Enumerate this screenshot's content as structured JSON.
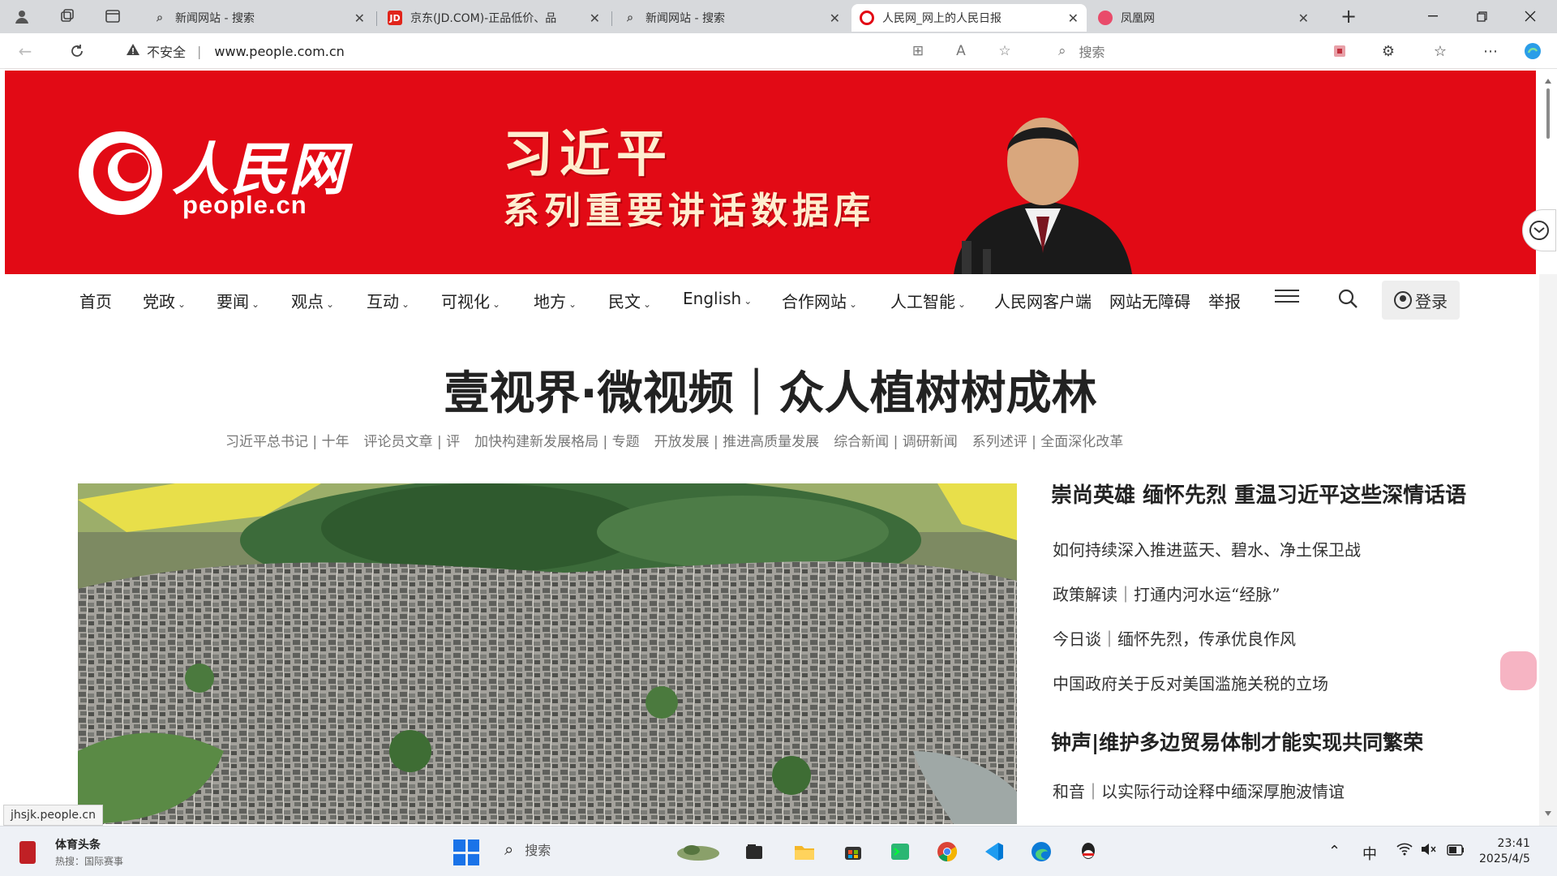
{
  "browser": {
    "tabs": [
      {
        "title": "新闻网站 - 搜索",
        "favicon": "search-icon",
        "active": false
      },
      {
        "title": "京东(JD.COM)-正品低价、品",
        "favicon": "jd-logo-icon",
        "active": false
      },
      {
        "title": "新闻网站 - 搜索",
        "favicon": "search-icon",
        "active": false
      },
      {
        "title": "人民网_网上的人民日报",
        "favicon": "people-logo-icon",
        "active": true
      },
      {
        "title": "凤凰网",
        "favicon": "ifeng-logo-icon",
        "active": false
      }
    ],
    "security_label": "不安全",
    "url": "www.people.com.cn",
    "search_placeholder": "搜索"
  },
  "banner": {
    "logo_cn": "人民网",
    "logo_en": "people.cn",
    "title_line1": "习近平",
    "title_line2": "系列重要讲话数据库",
    "color": "#e20a15"
  },
  "nav": {
    "items": [
      {
        "label": "首页",
        "dropdown": false
      },
      {
        "label": "党政",
        "dropdown": true
      },
      {
        "label": "要闻",
        "dropdown": true
      },
      {
        "label": "观点",
        "dropdown": true
      },
      {
        "label": "互动",
        "dropdown": true
      },
      {
        "label": "可视化",
        "dropdown": true
      },
      {
        "label": "地方",
        "dropdown": true
      },
      {
        "label": "民文",
        "dropdown": true
      },
      {
        "label": "English",
        "dropdown": true
      },
      {
        "label": "合作网站",
        "dropdown": true
      },
      {
        "label": "人工智能",
        "dropdown": true
      },
      {
        "label": "人民网客户端",
        "dropdown": false
      },
      {
        "label": "网站无障碍",
        "dropdown": false
      },
      {
        "label": "举报",
        "dropdown": false
      }
    ],
    "login_label": "登录"
  },
  "main": {
    "headline": "壹视界·微视频｜众人植树树成林",
    "subheads": [
      "习近平总书记 | 十年",
      "评论员文章 | 评",
      "加快构建新发展格局 | 专题",
      "开放发展 | 推进高质量发展",
      "综合新闻 | 调研新闻",
      "系列述评 | 全面深化改革"
    ],
    "side": {
      "heading1": "崇尚英雄 缅怀先烈 重温习近平这些深情话语",
      "items1": [
        "如何持续深入推进蓝天、碧水、净土保卫战",
        "政策解读｜打通内河水运“经脉”",
        "今日谈｜缅怀先烈，传承优良作风",
        "中国政府关于反对美国滥施关税的立场"
      ],
      "heading2": "钟声|维护多边贸易体制才能实现共同繁荣",
      "items2": [
        "和音｜以实际行动诠释中缅深厚胞波情谊"
      ]
    }
  },
  "status_url": "jhsjk.people.cn",
  "taskbar": {
    "widget_title": "体育头条",
    "widget_sub": "热搜：国际赛事",
    "search_label": "搜索",
    "apps": [
      "landscape-widget-icon",
      "file-explorer-icon",
      "folder-icon",
      "store-icon",
      "terminal-icon",
      "chrome-icon",
      "vscode-icon",
      "edge-icon",
      "qq-icon"
    ],
    "tray_ime": "中",
    "time": "23:41",
    "date": "2025/4/5"
  }
}
